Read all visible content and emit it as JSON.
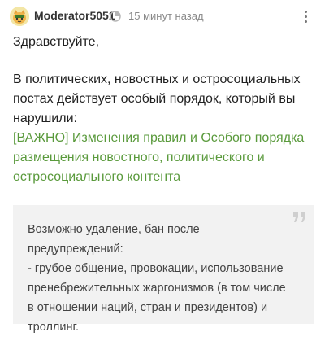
{
  "post": {
    "author": "Moderator5051",
    "time": "15 минут назад",
    "greeting": "Здравствуйте,",
    "body": "В политических, новостных и остросоциальных постах действует особый порядок, который вы нарушили:",
    "link_text": "[ВАЖНО] Изменения правил и Особого порядка размещения новостного, политического и остросоциального контента",
    "quote": "Возможно удаление, бан после предупреждений:\n- грубое общение, провокации, использование пренебрежительных жаргонизмов (в том числе в отношении наций, стран и президентов) и троллинг."
  },
  "icons": {
    "avatar": "cat-avatar-icon",
    "verified": "verified-icon",
    "more": "more-vertical-icon",
    "quote": "quote-icon"
  },
  "colors": {
    "link": "#5a9a3c",
    "quote_bg": "#f2f2f2",
    "muted": "#8a8a8a"
  }
}
